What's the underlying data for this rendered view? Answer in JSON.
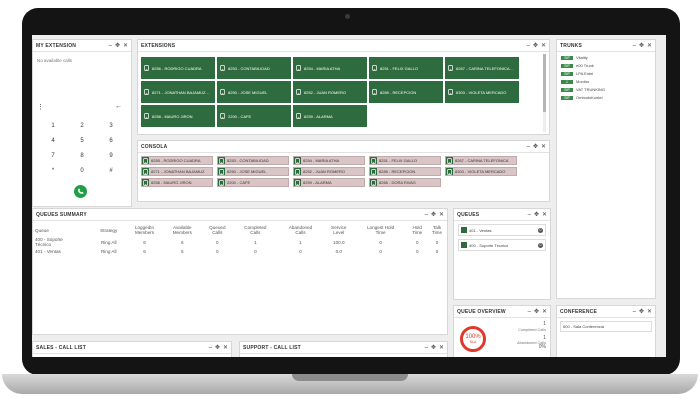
{
  "my_extension": {
    "title": "MY EXTENSION",
    "no_calls": "No available calls",
    "more_icon": "⋮",
    "backspace_icon": "←",
    "keys": [
      "1",
      "2",
      "3",
      "4",
      "5",
      "6",
      "7",
      "8",
      "9",
      "*",
      "0",
      "#"
    ]
  },
  "extensions": {
    "title": "EXTENSIONS",
    "items": [
      "8256 - RODRIGO CUADRA",
      "8253 - CONTABILIDAD",
      "8254 - MARIA ATHA",
      "8251 - FELIX GALLO",
      "8267 - CARINA TELEFONICA...",
      "8271 - JONATHAN BAJAMUZ...",
      "8250 - JOSE MIGUEL",
      "8252 - JUAN ROMERO",
      "8289 - RECEPCION",
      "8303 - VIOLETA MERCADO",
      "8258 - MAURO JIRON",
      "2200 - CAFE",
      "8259 - ALARMA"
    ]
  },
  "consola": {
    "title": "CONSOLA",
    "items": [
      "8255 - RODRIGO CUADRA",
      "8253 - CONTABILIDAD",
      "8254 - MARIA ATHA",
      "8251 - FELIX GALLO",
      "8267 - CARINA TELEFONICA",
      "8271 - JONATHAN BAJAMUZ",
      "8250 - JOSE MIGUEL",
      "8252 - JUAN ROMERO",
      "8289 - RECEPCION",
      "8303 - VIOLETA MERCADO",
      "8258 - MAURO JIRON",
      "2200 - CAFE",
      "8259 - ALARMA",
      "8266 - DORA RIVAS"
    ]
  },
  "trunks": {
    "title": "TRUNKS",
    "items": [
      {
        "badge": "SIP",
        "name": "Vitality"
      },
      {
        "badge": "SIP",
        "name": "e00 Trunk"
      },
      {
        "badge": "SIP",
        "name": "LPA Entel"
      },
      {
        "badge": "1",
        "name": "Monitor"
      },
      {
        "badge": "SIP",
        "name": "VAT TRUNKING"
      },
      {
        "badge": "SIP",
        "name": "OmbudsKontel"
      }
    ]
  },
  "queues_summary": {
    "title": "QUEUES SUMMARY",
    "headers": [
      [
        "Queue",
        ""
      ],
      [
        "Strategy",
        ""
      ],
      [
        "LoggedIn",
        "Members"
      ],
      [
        "Available",
        "Members"
      ],
      [
        "Queued",
        "Calls"
      ],
      [
        "Completed",
        "Calls"
      ],
      [
        "Abandoned",
        "Calls"
      ],
      [
        "Service",
        "Level"
      ],
      [
        "Longest Hold",
        "Time"
      ],
      [
        "Hold",
        "Time"
      ],
      [
        "Talk",
        "Time"
      ]
    ],
    "rows": [
      [
        [
          "400 - Soporte",
          "Técnico"
        ],
        "Ring All",
        "6",
        "6",
        "0",
        "1",
        "1",
        "100.0",
        "0",
        "0",
        "0"
      ],
      [
        [
          "401 - Ventas",
          ""
        ],
        "Ring All",
        "6",
        "6",
        "0",
        "0",
        "0",
        "0.0",
        "0",
        "0",
        "0"
      ]
    ]
  },
  "queues": {
    "title": "QUEUES",
    "items": [
      {
        "name": "401 - Ventas",
        "count": "0"
      },
      {
        "name": "400 - Soporte Técnico",
        "count": "0"
      }
    ]
  },
  "queue_overview": {
    "title": "QUEUE OVERVIEW",
    "percent": "100%",
    "sla_label": "SLA",
    "completed_value": "1",
    "completed_label": "Completed Calls",
    "abandoned_value": "1",
    "abandoned_label": "Abandoned Calls",
    "extra_value": "0%"
  },
  "conference": {
    "title": "CONFERENCE",
    "item": "600 - Sala Conferencia"
  },
  "sales_call_list": {
    "title": "SALES - CALL LIST"
  },
  "support_call_list": {
    "title": "SUPPORT - CALL LIST"
  },
  "colors": {
    "green": "#2e6b3e",
    "call_button": "#1fa047",
    "gauge": "#e0392b"
  }
}
